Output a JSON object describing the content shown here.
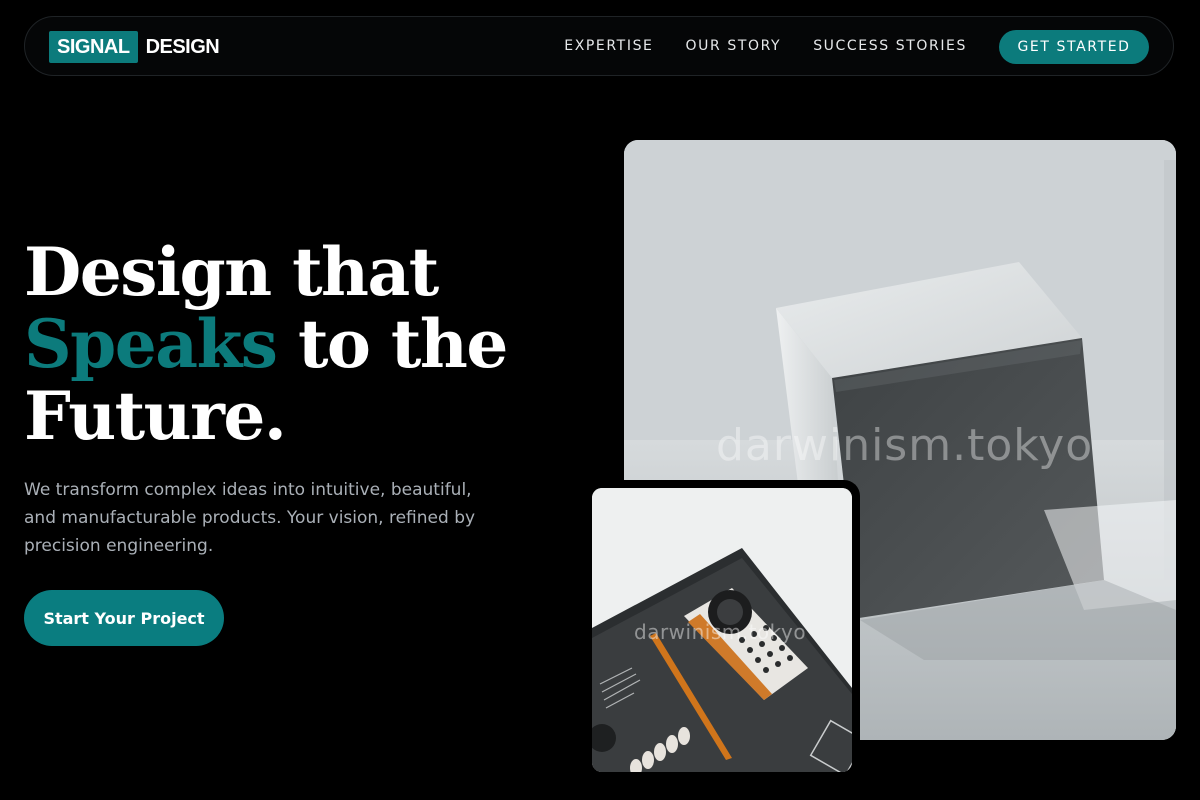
{
  "brand": {
    "logo_highlight": "SIGNAL",
    "logo_text": "DESIGN",
    "accent_color": "#0c7b7c"
  },
  "nav": {
    "items": [
      {
        "label": "EXPERTISE"
      },
      {
        "label": "OUR STORY"
      },
      {
        "label": "SUCCESS STORIES"
      }
    ],
    "cta_label": "GET STARTED"
  },
  "hero": {
    "headline_line1": "Design that",
    "headline_accent": "Speaks",
    "headline_line2_rest": " to the",
    "headline_line3": "Future.",
    "subcopy": "We transform complex ideas into intuitive, beautiful, and manufacturable products. Your vision, refined by precision engineering.",
    "cta_label": "Start Your Project"
  },
  "images": {
    "main_alt": "cube-photo",
    "inset_alt": "product-device-photo",
    "watermark": "darwinism.tokyo"
  }
}
